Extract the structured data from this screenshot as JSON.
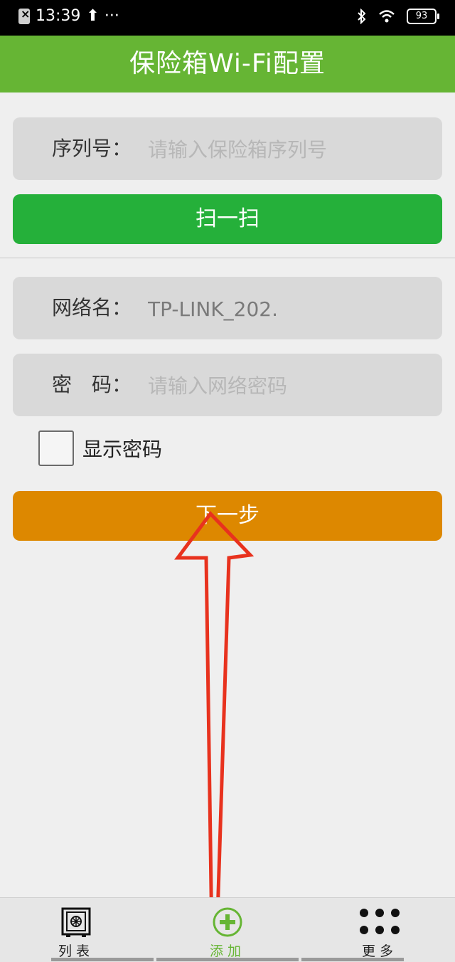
{
  "status_bar": {
    "time": "13:39",
    "extra_icons": "⬆ ···",
    "battery": "93"
  },
  "header": {
    "title": "保险箱Wi-Fi配置"
  },
  "serial": {
    "label": "序列号：",
    "placeholder": "请输入保险箱序列号",
    "value": ""
  },
  "scan_button": {
    "label": "扫一扫"
  },
  "network": {
    "label": "网络名：",
    "value": "TP-LINK_202."
  },
  "password": {
    "label": "密　码：",
    "placeholder": "请输入网络密码",
    "value": ""
  },
  "show_password": {
    "label": "显示密码",
    "checked": false
  },
  "next_button": {
    "label": "下一步"
  },
  "tabs": [
    {
      "label": "列表",
      "icon": "safe-icon",
      "active": false
    },
    {
      "label": "添加",
      "icon": "add-circle-icon",
      "active": true
    },
    {
      "label": "更多",
      "icon": "more-dots-icon",
      "active": false
    }
  ],
  "colors": {
    "header": "#66b534",
    "scan_button": "#25b03a",
    "next_button": "#dd8800",
    "annotation_arrow": "#e8321e"
  }
}
